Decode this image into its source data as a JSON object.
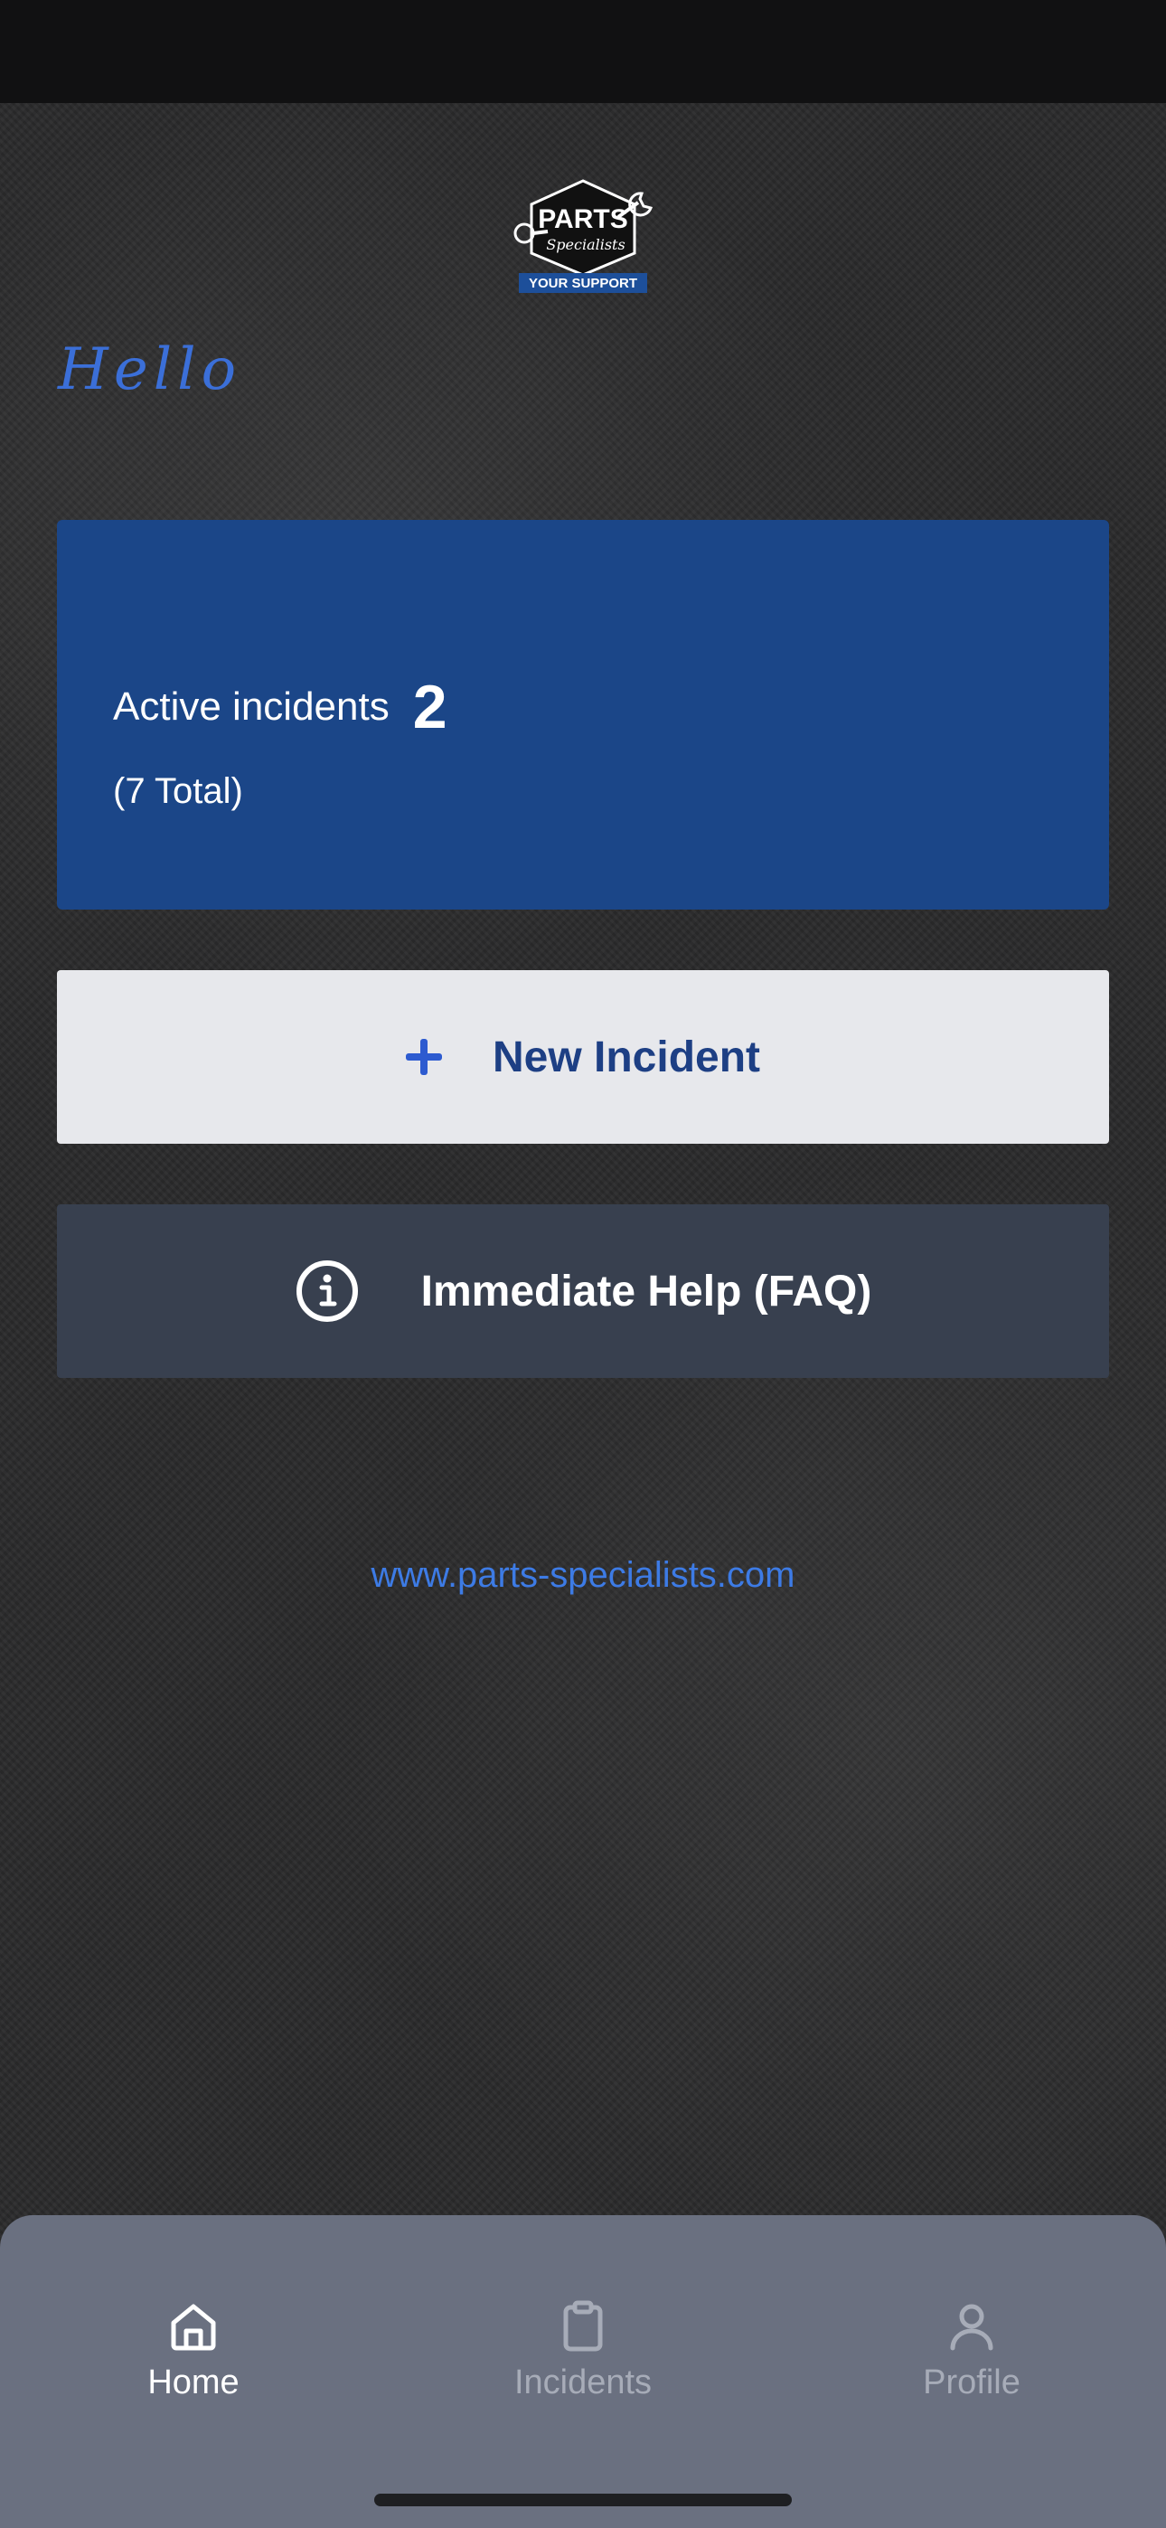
{
  "logo": {
    "brand_text": "PARTS",
    "script_text": "Specialists",
    "tagline": "YOUR SUPPORT"
  },
  "greeting": "Hello",
  "incidents_card": {
    "label": "Active incidents",
    "active_count": "2",
    "total_text": "(7 Total)"
  },
  "actions": {
    "new_incident_label": "New Incident",
    "faq_label": "Immediate Help (FAQ)"
  },
  "website": "www.parts-specialists.com",
  "bottom_nav": {
    "items": [
      {
        "label": "Home",
        "icon": "home-icon",
        "active": true
      },
      {
        "label": "Incidents",
        "icon": "clipboard-icon",
        "active": false
      },
      {
        "label": "Profile",
        "icon": "person-icon",
        "active": false
      }
    ]
  },
  "colors": {
    "accent": "#1b4688",
    "link": "#3d7be5",
    "nav_background": "#6a7080",
    "faq_background": "#38404f"
  }
}
